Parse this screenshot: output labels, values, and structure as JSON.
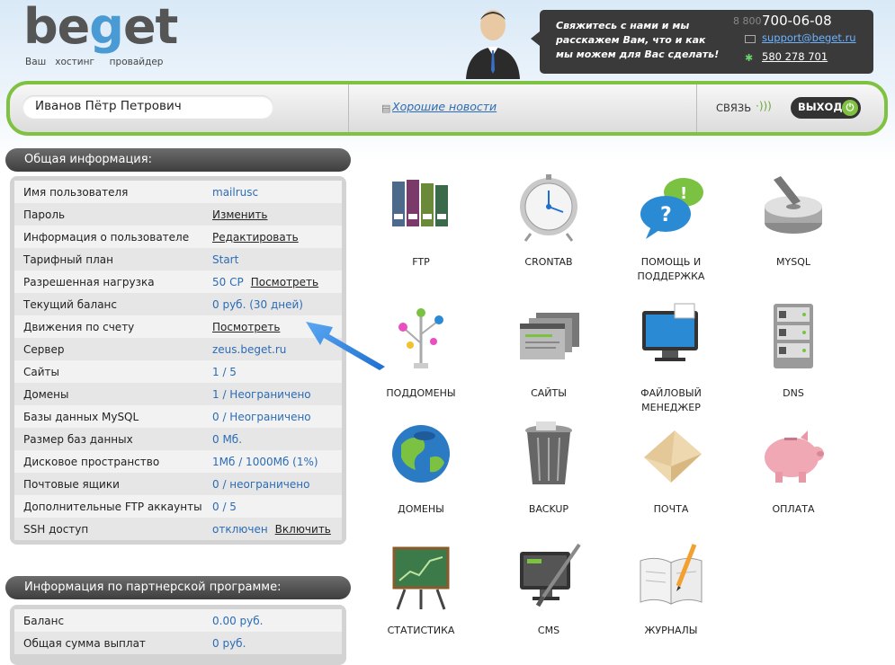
{
  "header": {
    "logo_word_pre": "be",
    "logo_word_g": "g",
    "logo_word_post": "et",
    "logo_tagline": "Ваш   хостинг     провайдер",
    "contact_text": "Свяжитесь с нами и мы расскажем Вам, что и как мы можем для Вас сделать!",
    "phone_prefix": "8 800",
    "phone": "700-06-08",
    "email": "support@beget.ru",
    "icq": "580 278 701"
  },
  "topbar": {
    "user_name": "Иванов Пётр Петрович",
    "news_link": "Хорошие новости",
    "contact_label": "СВЯЗЬ",
    "exit_label": "ВЫХОД"
  },
  "general": {
    "title": "Общая информация:",
    "rows": [
      {
        "label": "Имя пользователя",
        "value": "mailrusc",
        "action": ""
      },
      {
        "label": "Пароль",
        "value": "",
        "action": "Изменить"
      },
      {
        "label": "Информация о пользователе",
        "value": "",
        "action": "Редактировать"
      },
      {
        "label": "Тарифный план",
        "value": "Start",
        "action": ""
      },
      {
        "label": "Разрешенная нагрузка",
        "value": "50 CP",
        "action": "Посмотреть"
      },
      {
        "label": "Текущий баланс",
        "value": "0 руб. (30 дней)",
        "action": ""
      },
      {
        "label": "Движения по счету",
        "value": "",
        "action": "Посмотреть"
      },
      {
        "label": "Сервер",
        "value": "zeus.beget.ru",
        "action": ""
      },
      {
        "label": "Сайты",
        "value": "1 / 5",
        "action": ""
      },
      {
        "label": "Домены",
        "value": "1 / Неограничено",
        "action": ""
      },
      {
        "label": "Базы данных MySQL",
        "value": "0 / Неограничено",
        "action": ""
      },
      {
        "label": "Размер баз данных",
        "value": "0 Мб.",
        "action": ""
      },
      {
        "label": "Дисковое пространство",
        "value": "1Мб / 1000Мб (1%)",
        "action": ""
      },
      {
        "label": "Почтовые ящики",
        "value": "0 / неограничено",
        "action": ""
      },
      {
        "label": "Дополнительные FTP аккаунты",
        "value": "0 / 5",
        "action": ""
      },
      {
        "label": "SSH доступ",
        "value": "отключен",
        "action": "Включить"
      }
    ]
  },
  "partner": {
    "title": "Информация по партнерской программе:",
    "rows": [
      {
        "label": "Баланс",
        "value": "0.00 руб.",
        "action": ""
      },
      {
        "label": "Общая сумма выплат",
        "value": "0 руб.",
        "action": ""
      }
    ]
  },
  "tiles": [
    {
      "id": "ftp",
      "label": "FTP",
      "icon": "folders-icon"
    },
    {
      "id": "crontab",
      "label": "CRONTAB",
      "icon": "clock-icon"
    },
    {
      "id": "help",
      "label": "ПОМОЩЬ И ПОДДЕРЖКА",
      "icon": "speech-bubbles-icon"
    },
    {
      "id": "mysql",
      "label": "MYSQL",
      "icon": "database-disk-icon"
    },
    {
      "id": "subdomains",
      "label": "ПОДДОМЕНЫ",
      "icon": "tree-icon"
    },
    {
      "id": "sites",
      "label": "САЙТЫ",
      "icon": "browser-windows-icon"
    },
    {
      "id": "filemanager",
      "label": "ФАЙЛОВЫЙ МЕНЕДЖЕР",
      "icon": "monitor-icon"
    },
    {
      "id": "dns",
      "label": "DNS",
      "icon": "server-rack-icon"
    },
    {
      "id": "domains",
      "label": "ДОМЕНЫ",
      "icon": "globe-icon"
    },
    {
      "id": "backup",
      "label": "BACKUP",
      "icon": "trash-bin-icon"
    },
    {
      "id": "mail",
      "label": "ПОЧТА",
      "icon": "envelope-icon"
    },
    {
      "id": "payment",
      "label": "ОПЛАТА",
      "icon": "piggy-bank-icon"
    },
    {
      "id": "stats",
      "label": "СТАТИСТИКА",
      "icon": "chart-board-icon"
    },
    {
      "id": "cms",
      "label": "CMS",
      "icon": "brush-monitor-icon"
    },
    {
      "id": "logs",
      "label": "ЖУРНАЛЫ",
      "icon": "book-pencil-icon"
    }
  ],
  "colors": {
    "accent_green": "#7fc241",
    "link_blue": "#2b6cb5",
    "dark": "#3a3a3a"
  }
}
